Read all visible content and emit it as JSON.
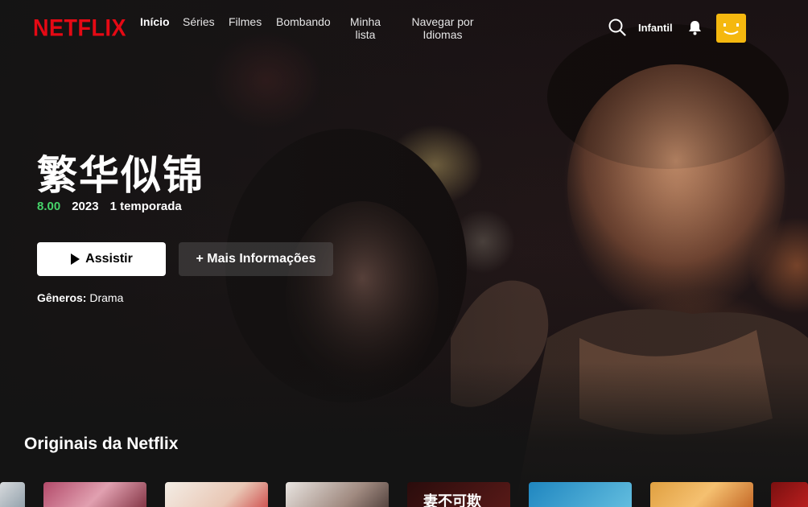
{
  "brand": {
    "logo": "NETFLIX",
    "logo_color": "#e50914"
  },
  "nav": {
    "links": [
      {
        "label": "Início",
        "active": true
      },
      {
        "label": "Séries"
      },
      {
        "label": "Filmes"
      },
      {
        "label": "Bombando"
      },
      {
        "label": "Minha lista"
      },
      {
        "label": "Navegar por Idiomas"
      }
    ],
    "kids_label": "Infantil",
    "icons": [
      "search-icon",
      "bell-icon"
    ],
    "avatar_color": "#f5b80f"
  },
  "hero": {
    "title": "繁华似锦",
    "rating": "8.00",
    "year": "2023",
    "seasons": "1 temporada",
    "play_label": "Assistir",
    "info_label": "+ Mais Informações",
    "genres_label": "Gêneros:",
    "genres_value": "Drama"
  },
  "row": {
    "title": "Originais da Netflix",
    "thumb_text": "妻不可欺"
  },
  "colors": {
    "rating_green": "#46d369",
    "background": "#141414"
  }
}
